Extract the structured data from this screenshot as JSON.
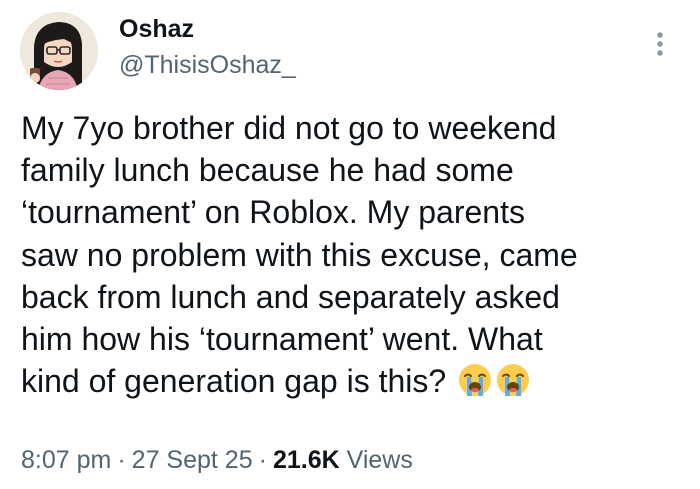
{
  "author": {
    "display_name": "Oshaz",
    "handle": "@ThisisOshaz_"
  },
  "tweet": {
    "text": "My 7yo brother did not go to weekend\nfamily lunch because he had some\n‘tournament’ on Roblox. My parents\nsaw no problem with this excuse, came\nback from lunch and separately asked\nhim how his ‘tournament’ went. What\nkind of generation gap is this?",
    "emojis": [
      "loudly-crying-face",
      "loudly-crying-face"
    ]
  },
  "meta": {
    "time": "8:07 pm",
    "separator": "·",
    "date": "27 Sept 25",
    "views_count": "21.6K",
    "views_label": "Views"
  },
  "colors": {
    "text": "#0f1419",
    "secondary": "#536471",
    "background": "#ffffff"
  }
}
